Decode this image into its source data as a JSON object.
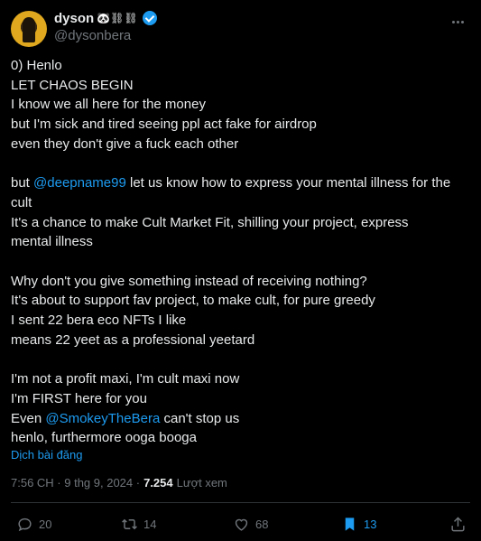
{
  "author": {
    "display_name": "dyson",
    "name_emojis": "🐼⛓⛓",
    "handle": "@dysonbera"
  },
  "tweet": {
    "lines": [
      [
        {
          "t": "0) Henlo"
        }
      ],
      [
        {
          "t": "LET CHAOS BEGIN"
        }
      ],
      [
        {
          "t": "I know we all here for the money"
        }
      ],
      [
        {
          "t": "but I'm sick and tired seeing ppl act fake for airdrop"
        }
      ],
      [
        {
          "t": "even they don't give a fuck each other"
        }
      ],
      [],
      [
        {
          "t": "but "
        },
        {
          "t": "@deepname99",
          "m": true
        },
        {
          "t": " let us know how to express your mental illness for the"
        }
      ],
      [
        {
          "t": "cult"
        }
      ],
      [
        {
          "t": "It's a chance to make Cult Market Fit, shilling your project, express"
        }
      ],
      [
        {
          "t": "mental illness"
        }
      ],
      [],
      [
        {
          "t": "Why don't you give something instead of receiving nothing?"
        }
      ],
      [
        {
          "t": "It's about to support fav project, to make cult, for pure greedy"
        }
      ],
      [
        {
          "t": "I sent 22 bera eco NFTs I like"
        }
      ],
      [
        {
          "t": "means 22 yeet as a professional yeetard"
        }
      ],
      [],
      [
        {
          "t": "I'm not a profit maxi, I'm cult maxi now"
        }
      ],
      [
        {
          "t": "I'm FIRST here for you"
        }
      ],
      [
        {
          "t": "Even "
        },
        {
          "t": "@SmokeyTheBera",
          "m": true
        },
        {
          "t": " can't stop us"
        }
      ],
      [
        {
          "t": "henlo, furthermore ooga booga"
        }
      ]
    ],
    "translate_label": "Dịch bài đăng",
    "timestamp": "7:56 CH · 9 thg 9, 2024 ·",
    "views_count": "7.254",
    "views_label": "Lượt xem"
  },
  "actions": {
    "replies": "20",
    "reposts": "14",
    "likes": "68",
    "bookmarks": "13"
  },
  "colors": {
    "background": "#000000",
    "text": "#e7e9ea",
    "muted": "#71767b",
    "accent": "#1d9bf0"
  }
}
